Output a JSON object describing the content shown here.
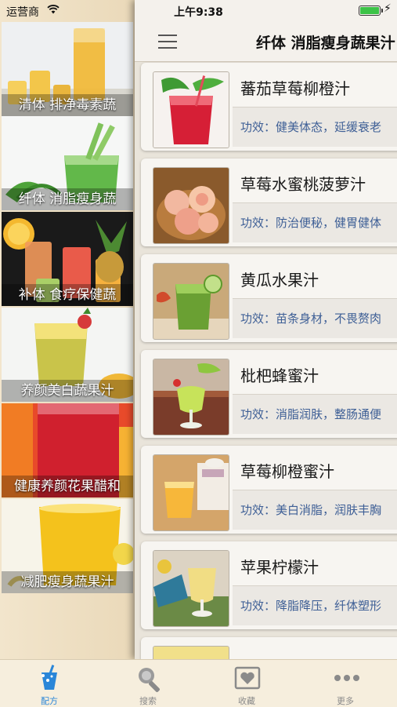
{
  "status_bar": {
    "carrier": "运营商",
    "time": "上午9:38",
    "battery_level": 1.0
  },
  "sidebar": {
    "categories": [
      {
        "label": "清体 排净毒素蔬"
      },
      {
        "label": "纤体 消脂瘦身蔬"
      },
      {
        "label": "补体 食疗保健蔬"
      },
      {
        "label": "养颜美白蔬果汁"
      },
      {
        "label": "健康养颜花果醋和"
      },
      {
        "label": "减肥瘦身蔬果汁"
      }
    ]
  },
  "header": {
    "title": "纤体 消脂瘦身蔬果汁"
  },
  "recipes": [
    {
      "title": "蕃茄草莓柳橙汁",
      "effect": "功效：健美体态，延缓衰老"
    },
    {
      "title": "草莓水蜜桃菠萝汁",
      "effect": "功效：防治便秘，健胃健体"
    },
    {
      "title": "黄瓜水果汁",
      "effect": "功效：苗条身材，不畏赘肉"
    },
    {
      "title": "枇杷蜂蜜汁",
      "effect": "功效：消脂润肤，整肠通便"
    },
    {
      "title": "草莓柳橙蜜汁",
      "effect": "功效：美白消脂，润肤丰胸"
    },
    {
      "title": "苹果柠檬汁",
      "effect": "功效：降脂降压，纤体塑形"
    }
  ],
  "tabs": [
    {
      "label": "配方",
      "icon": "recipe-drink-icon"
    },
    {
      "label": "搜索",
      "icon": "search-icon"
    },
    {
      "label": "收藏",
      "icon": "favorites-heart-icon"
    },
    {
      "label": "更多",
      "icon": "more-dots-icon"
    }
  ],
  "colors": {
    "accent": "#2a86d8",
    "effect_text": "#3e5f96",
    "battery": "#3cc347"
  }
}
